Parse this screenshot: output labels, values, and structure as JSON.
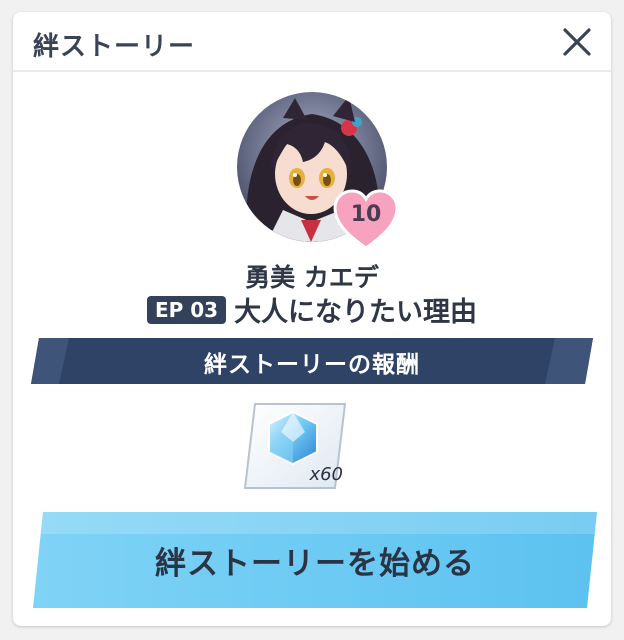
{
  "dialog": {
    "title": "絆ストーリー",
    "close_icon": "close-icon"
  },
  "character": {
    "portrait_icon": "character-portrait",
    "bond_level": "10",
    "name": "勇美 カエデ"
  },
  "episode": {
    "badge": "EP 03",
    "title": "大人になりたい理由"
  },
  "reward": {
    "banner_label": "絆ストーリーの報酬",
    "item_icon": "jewel-icon",
    "quantity": "x60"
  },
  "actions": {
    "start_label": "絆ストーリーを始める"
  },
  "colors": {
    "banner": "#2f4366",
    "button": "#67c9f3",
    "heart": "#f7a3bf",
    "text": "#2f3746"
  }
}
